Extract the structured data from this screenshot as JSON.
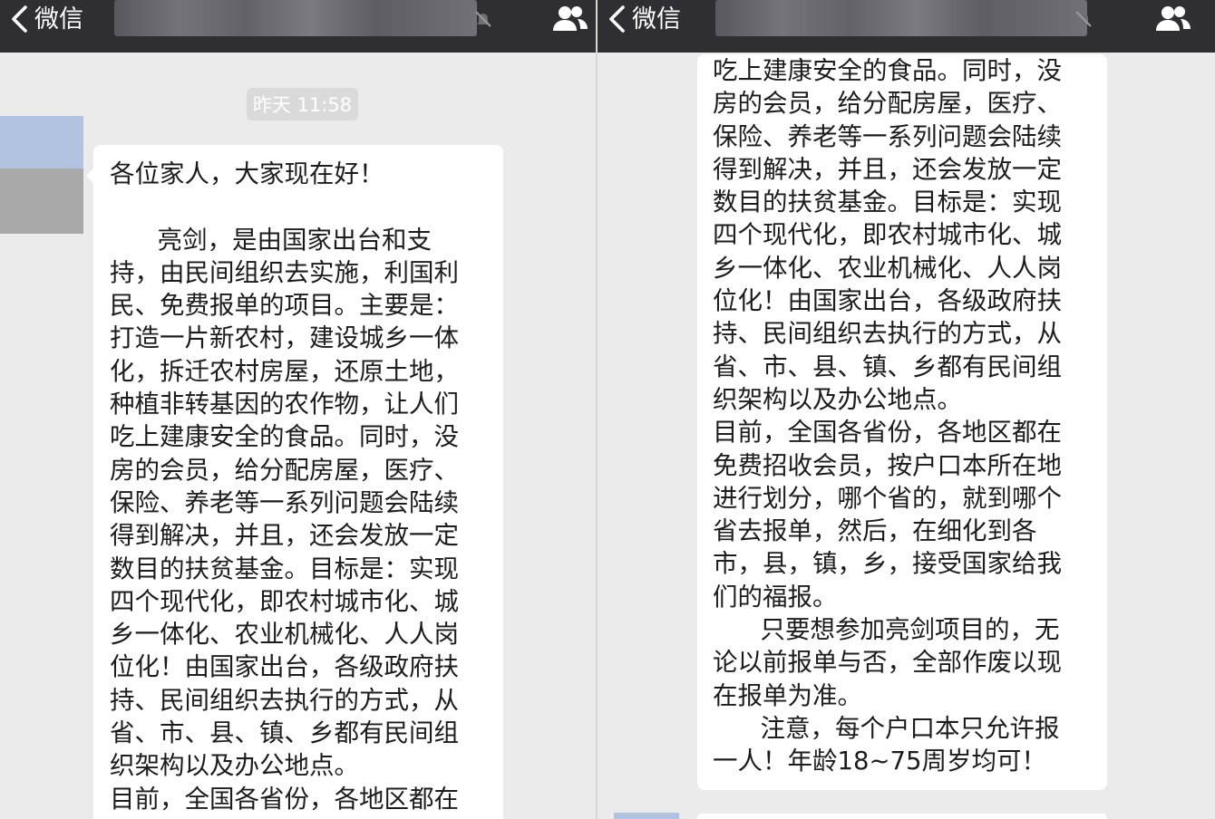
{
  "left": {
    "back_label": "微信",
    "timestamp": "昨天 11:58",
    "message_lines": [
      "各位家人，大家现在好！",
      "",
      "      亮剑，是由国家出台和支",
      "持，由民间组织去实施，利国利",
      "民、免费报单的项目。主要是：",
      "打造一片新农村，建设城乡一体",
      "化，拆迁农村房屋，还原土地，",
      "种植非转基因的农作物，让人们",
      "吃上建康安全的食品。同时，没",
      "房的会员，给分配房屋，医疗、",
      "保险、养老等一系列问题会陆续",
      "得到解决，并且，还会发放一定",
      "数目的扶贫基金。目标是：实现",
      "四个现代化，即农村城市化、城",
      "乡一体化、农业机械化、人人岗",
      "位化！由国家出台，各级政府扶",
      "持、民间组织去执行的方式，从",
      "省、市、县、镇、乡都有民间组",
      "织架构以及办公地点。",
      "目前，全国各省份，各地区都在"
    ]
  },
  "right": {
    "back_label": "微信",
    "message_lines": [
      "吃上建康安全的食品。同时，没",
      "房的会员，给分配房屋，医疗、",
      "保险、养老等一系列问题会陆续",
      "得到解决，并且，还会发放一定",
      "数目的扶贫基金。目标是：实现",
      "四个现代化，即农村城市化、城",
      "乡一体化、农业机械化、人人岗",
      "位化！由国家出台，各级政府扶",
      "持、民间组织去执行的方式，从",
      "省、市、县、镇、乡都有民间组",
      "织架构以及办公地点。",
      "目前，全国各省份，各地区都在",
      "免费招收会员，按户口本所在地",
      "进行划分，哪个省的，就到哪个",
      "省去报单，然后，在细化到各",
      "市，县，镇，乡，接受国家给我",
      "们的福报。",
      "      只要想参加亮剑项目的，无",
      "论以前报单与否，全部作废以现",
      "在报单为准。",
      "      注意，每个户口本只允许报",
      "一人！年龄18~75周岁均可！"
    ]
  },
  "icons": {
    "back": "chevron-left-icon",
    "mute": "mute-bell-icon",
    "group": "group-members-icon"
  },
  "colors": {
    "navbar": "#2f2f33",
    "chat_background": "#ebebeb",
    "bubble": "#ffffff",
    "timestamp_bg": "#dadada"
  }
}
